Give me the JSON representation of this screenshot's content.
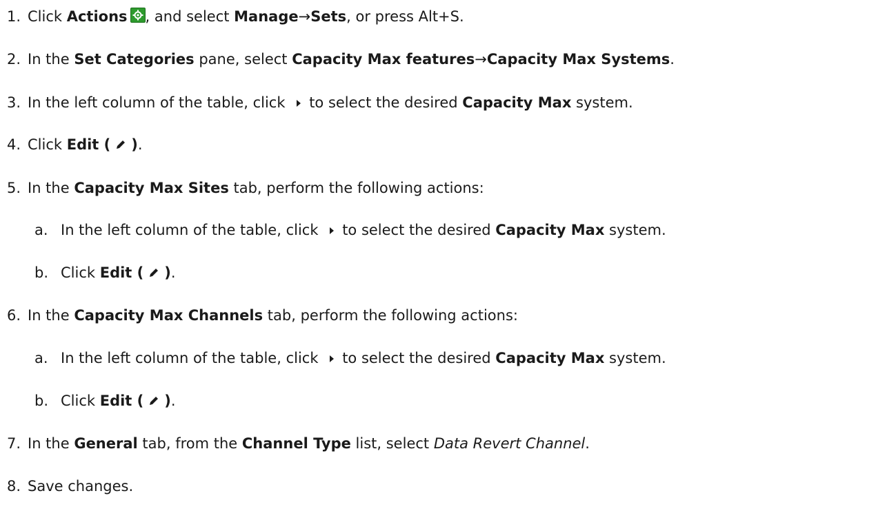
{
  "steps": [
    {
      "num": "1.",
      "parts": [
        "Click ",
        "Actions",
        ", and select ",
        "Manage",
        "→",
        "Sets",
        ", or press Alt+S."
      ]
    },
    {
      "num": "2.",
      "parts": [
        "In the ",
        "Set Categories",
        " pane, select ",
        "Capacity Max features",
        "→",
        "Capacity Max Systems",
        "."
      ]
    },
    {
      "num": "3.",
      "parts": [
        "In the left column of the table, click ",
        "to select the desired ",
        "Capacity Max",
        " system."
      ]
    },
    {
      "num": "4.",
      "parts": [
        "Click ",
        "Edit (",
        ")",
        "."
      ]
    },
    {
      "num": "5.",
      "parts": [
        "In the ",
        "Capacity Max Sites",
        " tab, perform the following actions:"
      ]
    },
    {
      "num": "a.",
      "parts": [
        "In the left column of the table, click ",
        "to select the desired ",
        "Capacity Max",
        " system."
      ]
    },
    {
      "num": "b.",
      "parts": [
        "Click ",
        "Edit (",
        ")",
        "."
      ]
    },
    {
      "num": "6.",
      "parts": [
        "In the ",
        "Capacity Max Channels",
        " tab, perform the following actions:"
      ]
    },
    {
      "num": "a.",
      "parts": [
        "In the left column of the table, click ",
        "to select the desired ",
        "Capacity Max",
        " system."
      ]
    },
    {
      "num": "b.",
      "parts": [
        "Click ",
        "Edit (",
        ")",
        "."
      ]
    },
    {
      "num": "7.",
      "parts": [
        "In the ",
        "General",
        " tab, from the ",
        "Channel Type",
        " list, select ",
        "Data Revert Channel",
        "."
      ]
    },
    {
      "num": "8.",
      "parts": [
        "Save changes."
      ]
    }
  ],
  "colors": {
    "text": "#1a1a1a",
    "gear_icon_bg": "#2e9a2e"
  },
  "icons": [
    "gear-icon",
    "triangle-right-icon",
    "pencil-icon"
  ]
}
